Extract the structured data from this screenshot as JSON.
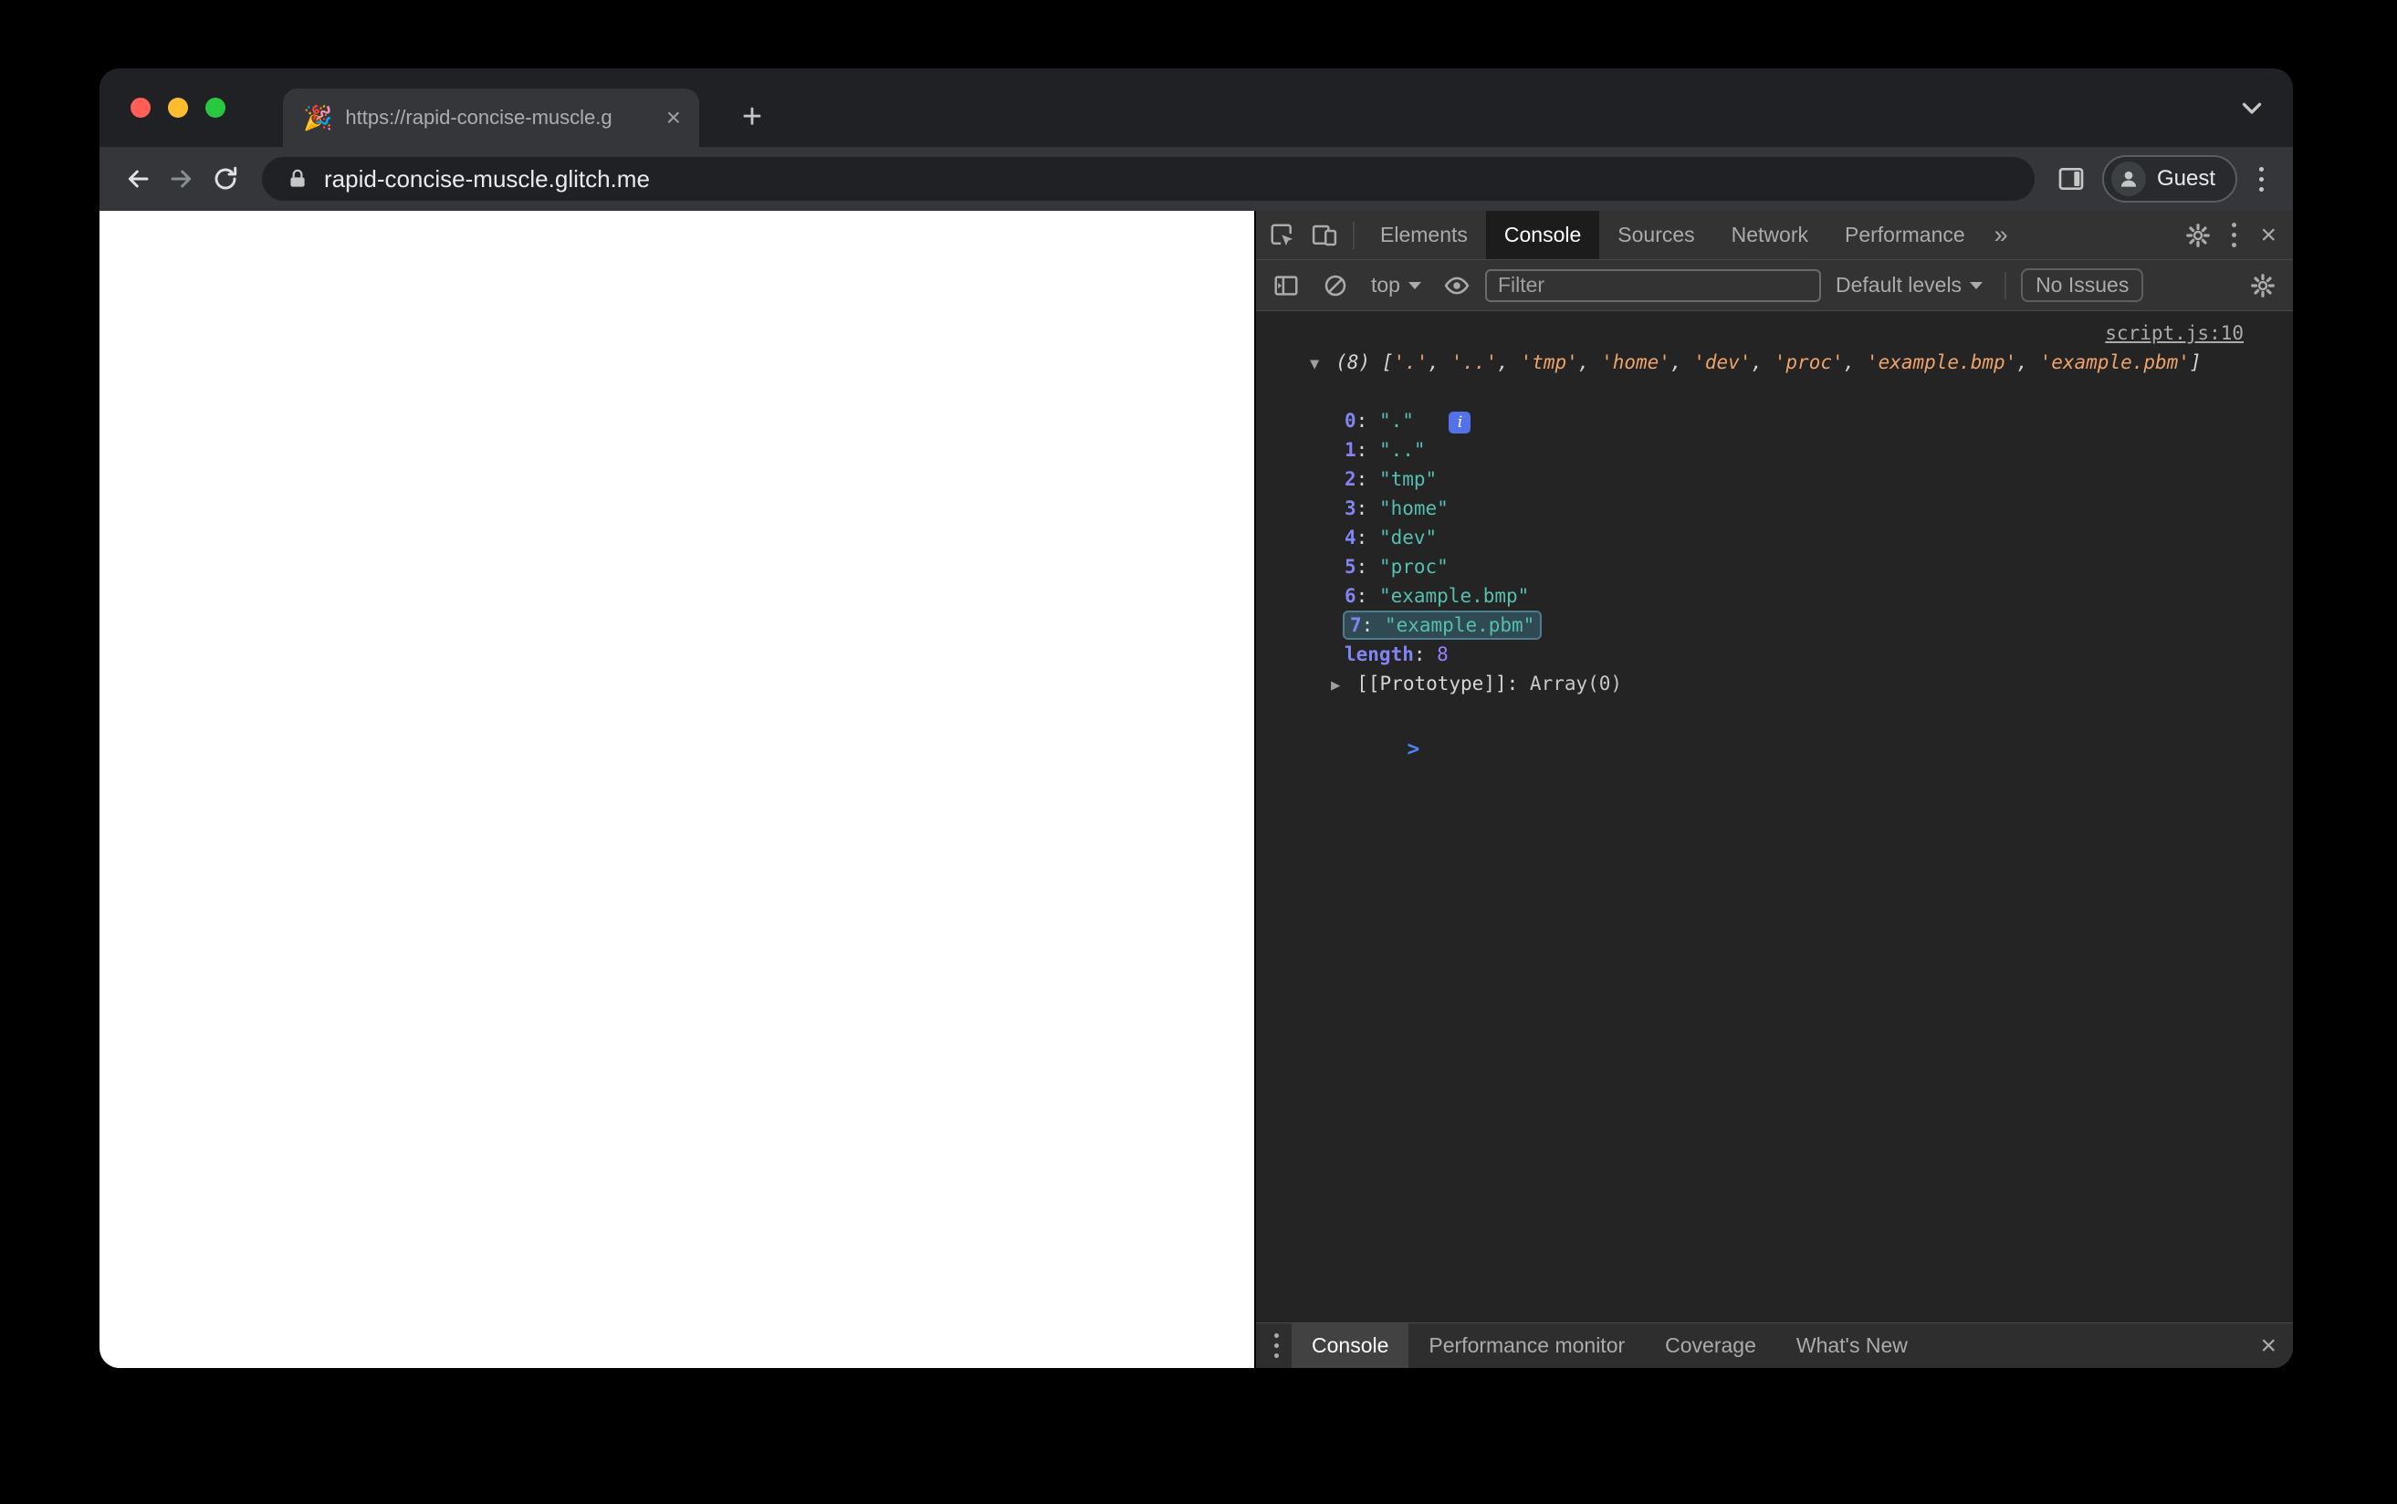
{
  "browser": {
    "tab_favicon": "🎉",
    "tab_title": "https://rapid-concise-muscle.g",
    "url": "rapid-concise-muscle.glitch.me",
    "profile": "Guest"
  },
  "icons": {
    "close_x": "×",
    "more_tabs": "»",
    "new_tab_plus": "+",
    "caret_open": "▼",
    "caret_closed": "▶",
    "info_badge": "i"
  },
  "devtools": {
    "main_tabs": [
      "Elements",
      "Console",
      "Sources",
      "Network",
      "Performance"
    ],
    "toolbar": {
      "context": "top",
      "filter_placeholder": "Filter",
      "levels": "Default levels",
      "issues": "No Issues"
    },
    "console": {
      "source_link": "script.js:10",
      "preview_parts": [
        "(8) [",
        "'.'",
        ", ",
        "'..'",
        ", ",
        "'tmp'",
        ", ",
        "'home'",
        ", ",
        "'dev'",
        ", ",
        "'proc'",
        ", ",
        "'example.bmp'",
        ", ",
        "'example.pbm'",
        "]"
      ],
      "colon": ": ",
      "items": [
        {
          "k": "0",
          "v": "\".\""
        },
        {
          "k": "1",
          "v": "\"..\""
        },
        {
          "k": "2",
          "v": "\"tmp\""
        },
        {
          "k": "3",
          "v": "\"home\""
        },
        {
          "k": "4",
          "v": "\"dev\""
        },
        {
          "k": "5",
          "v": "\"proc\""
        },
        {
          "k": "6",
          "v": "\"example.bmp\""
        },
        {
          "k": "7",
          "v": "\"example.pbm\""
        }
      ],
      "length_key": "length",
      "length_value": "8",
      "prototype_key": "[[Prototype]]",
      "prototype_value": "Array(0)",
      "prompt": ">"
    },
    "drawer_tabs": [
      "Console",
      "Performance monitor",
      "Coverage",
      "What's New"
    ]
  },
  "colors": {
    "traffic_close": "#FF5F57",
    "traffic_minimize": "#FEBC2E",
    "traffic_zoom": "#28C840",
    "console_string_preview": "#EDA36A",
    "console_string_value": "#55BFB0",
    "console_key": "#8185F2",
    "console_number": "#9980FF",
    "prompt_blue": "#4E83EC",
    "highlight_row": "#2F4A52"
  }
}
